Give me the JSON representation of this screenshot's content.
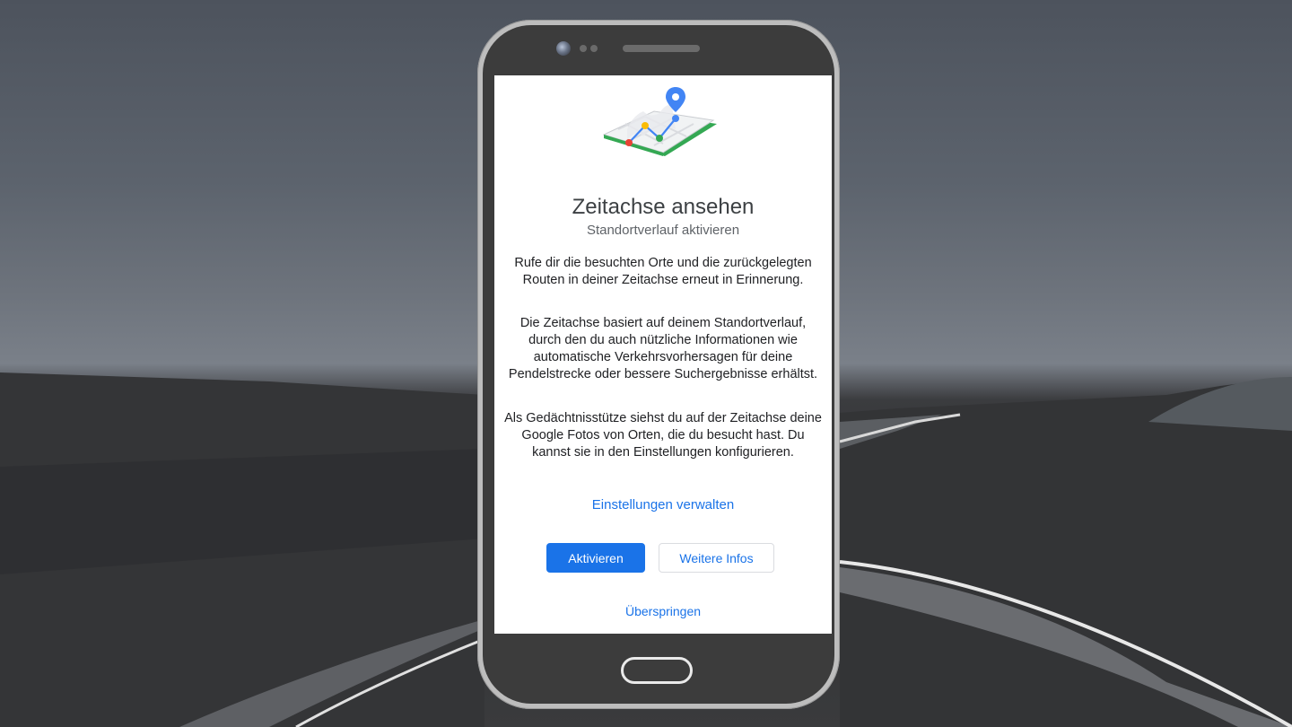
{
  "screen": {
    "illustration_icon": "timeline-map-icon",
    "title": "Zeitachse ansehen",
    "subtitle": "Standortverlauf aktivieren",
    "paragraphs": [
      "Rufe dir die besuchten Orte und die zurückgelegten Routen in deiner Zeitachse erneut in Erinnerung.",
      "Die Zeitachse basiert auf deinem Standortverlauf, durch den du auch nützliche Informationen wie automatische Verkehrsvorhersagen für deine Pendelstrecke oder bessere Suchergebnisse erhältst.",
      "Als Gedächtnisstütze siehst du auf der Zeitachse deine Google Fotos von Orten, die du besucht hast. Du kannst sie in den Einstellungen konfigurieren."
    ],
    "manage_link": "Einstellungen verwalten",
    "activate_button": "Aktivieren",
    "more_info_button": "Weitere Infos",
    "skip_link": "Überspringen"
  },
  "colors": {
    "accent": "#1a73e8",
    "pin": "#4285f4",
    "map_border": "#34a853",
    "dot_red": "#ea4335",
    "dot_yellow": "#fbbc04",
    "dot_green": "#34a853"
  }
}
